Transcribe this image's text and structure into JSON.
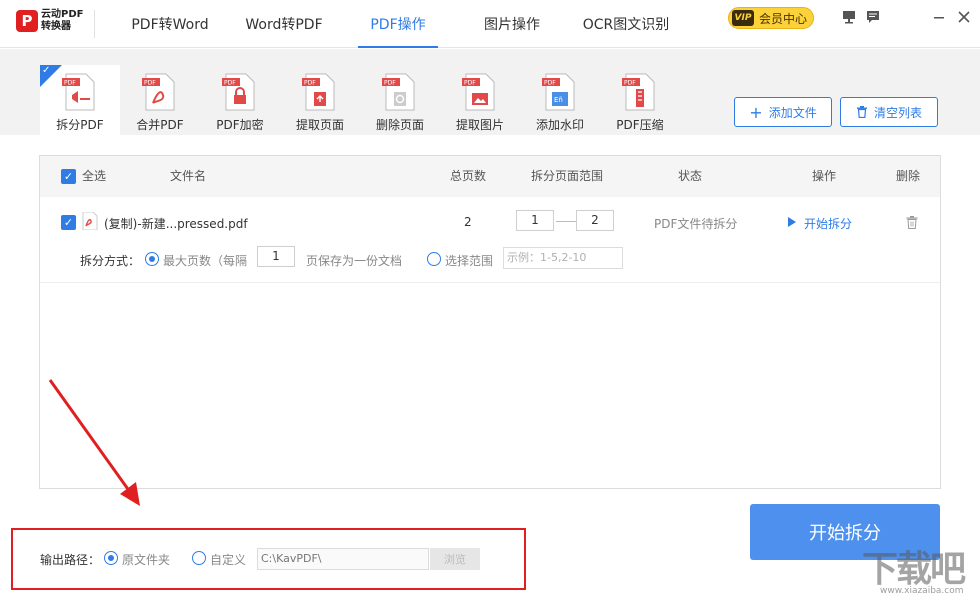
{
  "app": {
    "logo_line1": "云动PDF",
    "logo_line2": "转换器",
    "nav": [
      "PDF转Word",
      "Word转PDF",
      "PDF操作",
      "图片操作",
      "OCR图文识别"
    ],
    "active_nav": "PDF操作",
    "vip_tag": "VIP",
    "vip_label": "会员中心"
  },
  "toolbar": {
    "tools": [
      "拆分PDF",
      "合并PDF",
      "PDF加密",
      "提取页面",
      "删除页面",
      "提取图片",
      "添加水印",
      "PDF压缩"
    ],
    "active_tool": "拆分PDF",
    "add_file": "添加文件",
    "clear_list": "清空列表"
  },
  "table": {
    "headers": {
      "select_all": "全选",
      "filename": "文件名",
      "total_pages": "总页数",
      "split_range": "拆分页面范围",
      "status": "状态",
      "action": "操作",
      "delete": "删除"
    },
    "rows": [
      {
        "filename": "(复制)-新建...pressed.pdf",
        "total_pages": "2",
        "range_from": "1",
        "range_to": "2",
        "status": "PDF文件待拆分",
        "action": "开始拆分"
      }
    ],
    "split_mode_label": "拆分方式：",
    "mode_max_pages": "最大页数（每隔",
    "mode_max_pages_value": "1",
    "mode_max_pages_suffix": "页保存为一份文档",
    "mode_range": "选择范围",
    "mode_range_placeholder": "示例：1-5,2-10"
  },
  "output": {
    "label": "输出路径：",
    "opt_source": "原文件夹",
    "opt_custom": "自定义",
    "path": "C:\\KavPDF\\",
    "browse": "浏览"
  },
  "start_button": "开始拆分",
  "watermark": "下载吧",
  "watermark_sub": "www.xiazaiba.com",
  "colors": {
    "accent": "#2f7ce6",
    "start_button": "#4e90ee",
    "highlight": "#e02020",
    "vip": "#fbd23a"
  }
}
